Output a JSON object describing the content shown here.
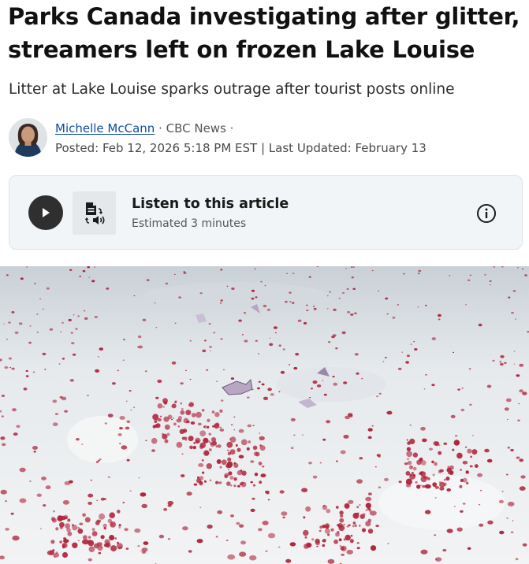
{
  "article": {
    "headline": "Parks Canada investigating after glitter, streamers left on frozen Lake Louise",
    "deck": "Litter at Lake Louise sparks outrage after tourist posts online"
  },
  "byline": {
    "author": "Michelle McCann",
    "separator_1": " · ",
    "source": "CBC News",
    "separator_2": " ·",
    "posted": "Posted: Feb 12, 2026 5:18 PM EST | Last Updated: February 13"
  },
  "listen": {
    "title": "Listen to this article",
    "subtitle": "Estimated 3 minutes",
    "play_icon": "play-icon",
    "audio_icon": "document-audio-icon",
    "info_icon": "info-icon"
  },
  "colors": {
    "author_link": "#0d4b9c",
    "card_background": "#f1f5f7",
    "play_button": "#2f2f2f",
    "glitter": "#b0243a"
  }
}
